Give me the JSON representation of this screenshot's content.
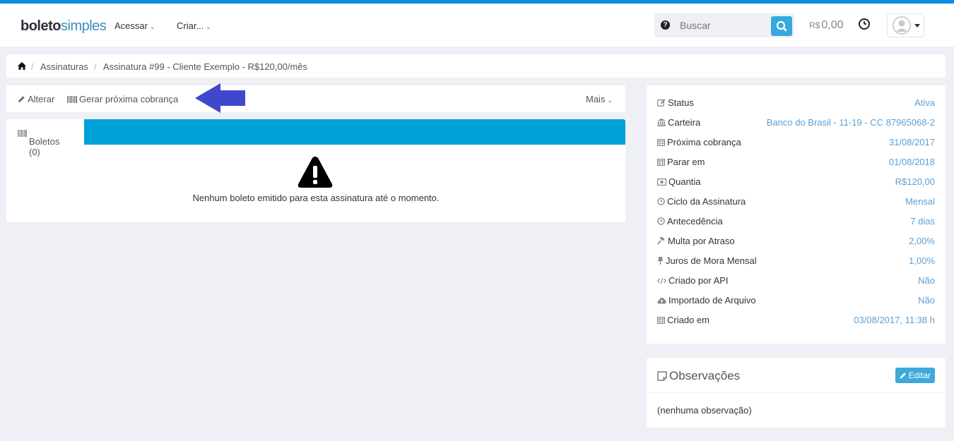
{
  "header": {
    "logo_part1": "boleto",
    "logo_part2": "simples",
    "menu_access": "Acessar",
    "menu_create": "Criar...",
    "search_placeholder": "Buscar",
    "search_help": "?",
    "balance_currency": "R$",
    "balance_amount": "0,00"
  },
  "breadcrumb": {
    "subscriptions": "Assinaturas",
    "current": "Assinatura #99 - Cliente Exemplo - R$120,00/mês"
  },
  "toolbar": {
    "edit_label": "Alterar",
    "generate_label": "Gerar próxima cobrança",
    "more_label": "Mais"
  },
  "tabs": {
    "boletos_label": "Boletos (0)",
    "empty_message": "Nenhum boleto emitido para esta assinatura até o momento."
  },
  "details": [
    {
      "label": "Status",
      "value": "Ativa",
      "icon": "edit-icon"
    },
    {
      "label": "Carteira",
      "value": "Banco do Brasil - 11-19 - CC 87965068-2",
      "icon": "bank-icon"
    },
    {
      "label": "Próxima cobrança",
      "value": "31/08/2017",
      "icon": "calendar-icon"
    },
    {
      "label": "Parar em",
      "value": "01/08/2018",
      "icon": "calendar-icon"
    },
    {
      "label": "Quantia",
      "value": "R$120,00",
      "icon": "money-icon"
    },
    {
      "label": "Ciclo da Assinatura",
      "value": "Mensal",
      "icon": "clock-icon"
    },
    {
      "label": "Antecedência",
      "value": "7 dias",
      "icon": "clock-icon"
    },
    {
      "label": "Multa por Atraso",
      "value": "2,00%",
      "icon": "gavel-icon"
    },
    {
      "label": "Juros de Mora Mensal",
      "value": "1,00%",
      "icon": "pin-icon"
    },
    {
      "label": "Criado por API",
      "value": "Não",
      "icon": "code-icon"
    },
    {
      "label": "Importado de Arquivo",
      "value": "Não",
      "icon": "cloud-upload-icon"
    },
    {
      "label": "Criado em",
      "value": "03/08/2017, 11:38 h",
      "icon": "calendar-icon"
    }
  ],
  "notes": {
    "title": "Observações",
    "edit_label": "Editar",
    "body": "(nenhuma observação)"
  },
  "colors": {
    "accent": "#0b8ee0",
    "tab_bar": "#00a0d8",
    "value_text": "#5b9fd4",
    "arrow": "#3f48cc"
  }
}
